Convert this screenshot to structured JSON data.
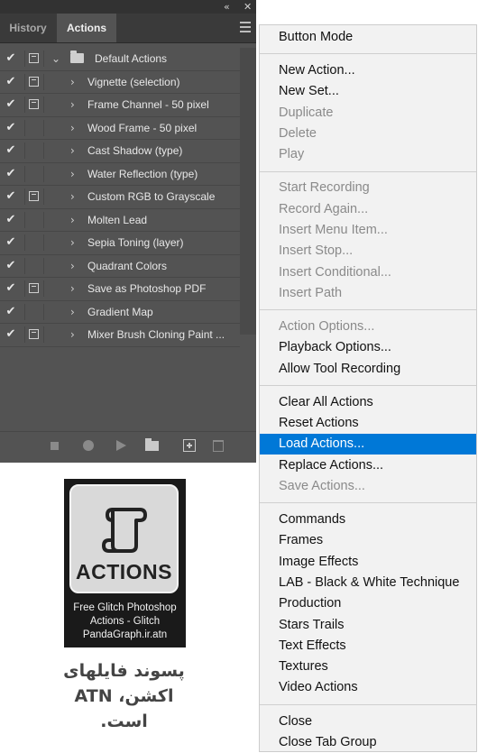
{
  "panel": {
    "tabs": [
      {
        "label": "History",
        "active": false
      },
      {
        "label": "Actions",
        "active": true
      }
    ],
    "collapse_glyph": "«",
    "close_glyph": "✕",
    "check_glyph": "✔",
    "actions": [
      {
        "label": "Default Actions",
        "type": "set",
        "checked": true,
        "dialog": true,
        "expanded": true
      },
      {
        "label": "Vignette (selection)",
        "type": "action",
        "checked": true,
        "dialog": true
      },
      {
        "label": "Frame Channel - 50 pixel",
        "type": "action",
        "checked": true,
        "dialog": true
      },
      {
        "label": "Wood Frame - 50 pixel",
        "type": "action",
        "checked": true,
        "dialog": false
      },
      {
        "label": "Cast Shadow (type)",
        "type": "action",
        "checked": true,
        "dialog": false
      },
      {
        "label": "Water Reflection (type)",
        "type": "action",
        "checked": true,
        "dialog": false
      },
      {
        "label": "Custom RGB to Grayscale",
        "type": "action",
        "checked": true,
        "dialog": true
      },
      {
        "label": "Molten Lead",
        "type": "action",
        "checked": true,
        "dialog": false
      },
      {
        "label": "Sepia Toning (layer)",
        "type": "action",
        "checked": true,
        "dialog": false
      },
      {
        "label": "Quadrant Colors",
        "type": "action",
        "checked": true,
        "dialog": false
      },
      {
        "label": "Save as Photoshop PDF",
        "type": "action",
        "checked": true,
        "dialog": true
      },
      {
        "label": "Gradient Map",
        "type": "action",
        "checked": true,
        "dialog": false
      },
      {
        "label": "Mixer Brush Cloning Paint ...",
        "type": "action",
        "checked": true,
        "dialog": true
      }
    ],
    "bottom_buttons": [
      "stop-icon",
      "record-icon",
      "play-icon",
      "folder-icon",
      "new-item-icon",
      "trash-icon"
    ]
  },
  "menu": {
    "groups": [
      [
        {
          "label": "Button Mode",
          "enabled": true
        }
      ],
      [
        {
          "label": "New Action...",
          "enabled": true
        },
        {
          "label": "New Set...",
          "enabled": true
        },
        {
          "label": "Duplicate",
          "enabled": false
        },
        {
          "label": "Delete",
          "enabled": false
        },
        {
          "label": "Play",
          "enabled": false
        }
      ],
      [
        {
          "label": "Start Recording",
          "enabled": false
        },
        {
          "label": "Record Again...",
          "enabled": false
        },
        {
          "label": "Insert Menu Item...",
          "enabled": false
        },
        {
          "label": "Insert Stop...",
          "enabled": false
        },
        {
          "label": "Insert Conditional...",
          "enabled": false
        },
        {
          "label": "Insert Path",
          "enabled": false
        }
      ],
      [
        {
          "label": "Action Options...",
          "enabled": false
        },
        {
          "label": "Playback Options...",
          "enabled": true
        },
        {
          "label": "Allow Tool Recording",
          "enabled": true
        }
      ],
      [
        {
          "label": "Clear All Actions",
          "enabled": true
        },
        {
          "label": "Reset Actions",
          "enabled": true
        },
        {
          "label": "Load Actions...",
          "enabled": true,
          "highlighted": true
        },
        {
          "label": "Replace Actions...",
          "enabled": true
        },
        {
          "label": "Save Actions...",
          "enabled": false
        }
      ],
      [
        {
          "label": "Commands",
          "enabled": true
        },
        {
          "label": "Frames",
          "enabled": true
        },
        {
          "label": "Image Effects",
          "enabled": true
        },
        {
          "label": "LAB - Black & White Technique",
          "enabled": true
        },
        {
          "label": "Production",
          "enabled": true
        },
        {
          "label": "Stars Trails",
          "enabled": true
        },
        {
          "label": "Text Effects",
          "enabled": true
        },
        {
          "label": "Textures",
          "enabled": true
        },
        {
          "label": "Video Actions",
          "enabled": true
        }
      ],
      [
        {
          "label": "Close",
          "enabled": true
        },
        {
          "label": "Close Tab Group",
          "enabled": true
        }
      ]
    ],
    "highlight_color": "#0078d7"
  },
  "file_icon": {
    "word": "ACTIONS",
    "caption_lines": [
      "Free Glitch Photoshop",
      "Actions - Glitch",
      "PandaGraph.ir.atn"
    ]
  },
  "caption": {
    "lines": [
      "پسوند فایلهای",
      "اکشن، ATN",
      "است."
    ]
  }
}
